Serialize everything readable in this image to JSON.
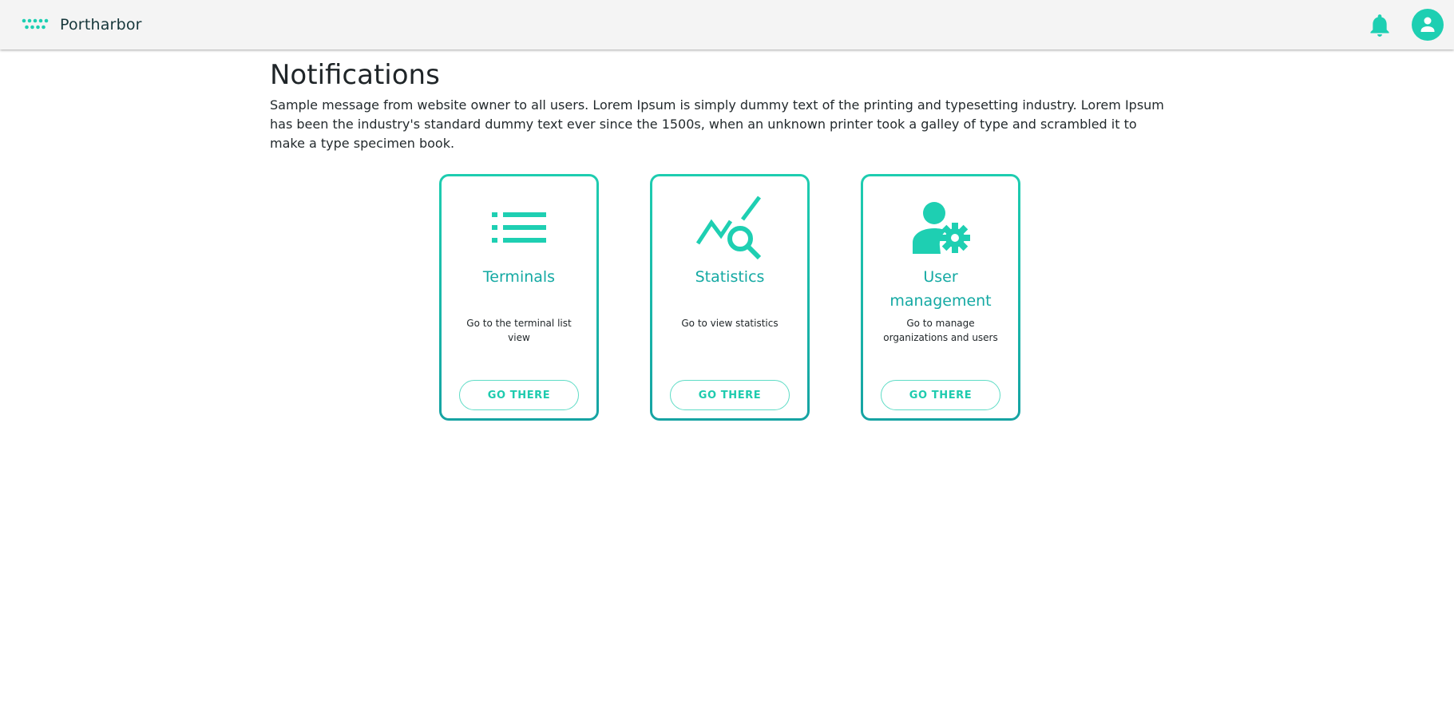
{
  "app": {
    "name": "Portharbor",
    "accent_color": "#1ecfb2",
    "logo_icon": "dots-logo-icon",
    "notification_icon": "bell-icon",
    "account_icon": "user-avatar-icon"
  },
  "main": {
    "title": "Notifications",
    "message": "Sample message from website owner to all users. Lorem Ipsum is simply dummy text of the printing and typesetting industry. Lorem Ipsum has been the industry's standard dummy text ever since the 1500s, when an unknown printer took a galley of type and scrambled it to make a type specimen book."
  },
  "cards": [
    {
      "icon": "list-icon",
      "title": "Terminals",
      "description": "Go to the terminal list view",
      "button": "GO THERE"
    },
    {
      "icon": "statistics-search-icon",
      "title": "Statistics",
      "description": "Go to view statistics",
      "button": "GO THERE"
    },
    {
      "icon": "user-settings-icon",
      "title": "User management",
      "description": "Go to manage organizations and users",
      "button": "GO THERE"
    }
  ]
}
